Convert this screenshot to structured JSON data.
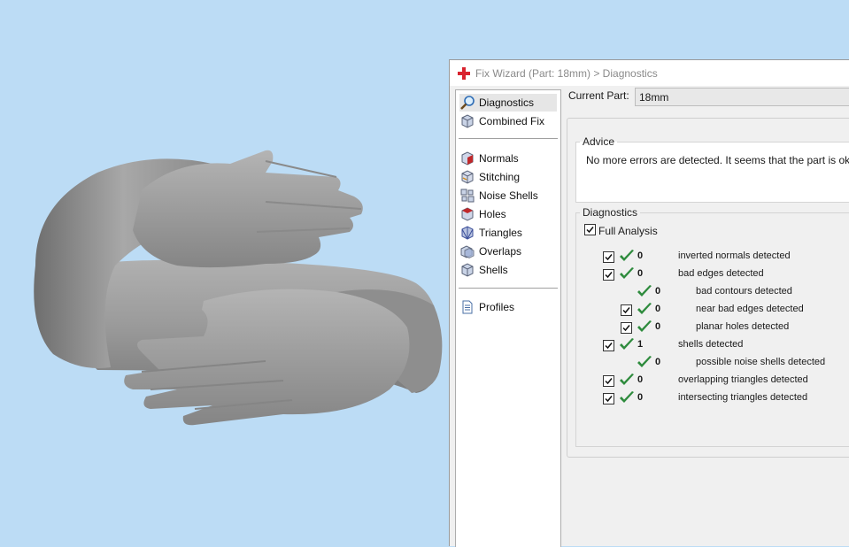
{
  "window": {
    "title": "Fix Wizard (Part: 18mm) > Diagnostics"
  },
  "nav": {
    "top": [
      {
        "name": "diagnostics",
        "label": "Diagnostics",
        "icon": "magnifier-icon",
        "selected": true
      },
      {
        "name": "combined-fix",
        "label": "Combined Fix",
        "icon": "cube-icon"
      }
    ],
    "tools": [
      {
        "name": "normals",
        "label": "Normals",
        "icon": "normals-cube-icon"
      },
      {
        "name": "stitching",
        "label": "Stitching",
        "icon": "stitching-cube-icon"
      },
      {
        "name": "noise-shells",
        "label": "Noise Shells",
        "icon": "noise-shells-icon"
      },
      {
        "name": "holes",
        "label": "Holes",
        "icon": "holes-cube-icon"
      },
      {
        "name": "triangles",
        "label": "Triangles",
        "icon": "triangles-icon"
      },
      {
        "name": "overlaps",
        "label": "Overlaps",
        "icon": "overlaps-icon"
      },
      {
        "name": "shells",
        "label": "Shells",
        "icon": "shells-icon"
      }
    ],
    "bottom": [
      {
        "name": "profiles",
        "label": "Profiles",
        "icon": "document-icon"
      }
    ]
  },
  "current_part": {
    "label": "Current Part:",
    "value": "18mm"
  },
  "advice": {
    "legend": "Advice",
    "text": "No more errors are detected. It seems that the part is ok."
  },
  "diagnostics": {
    "legend": "Diagnostics",
    "full_analysis": {
      "label": "Full Analysis",
      "checked": true
    },
    "rows": [
      {
        "count": "0",
        "label": "inverted normals detected",
        "level": 0,
        "checkbox": true
      },
      {
        "count": "0",
        "label": "bad edges detected",
        "level": 0,
        "checkbox": true
      },
      {
        "count": "0",
        "label": "bad contours detected",
        "level": 1,
        "checkbox": false
      },
      {
        "count": "0",
        "label": "near bad edges detected",
        "level": 1,
        "checkbox": true
      },
      {
        "count": "0",
        "label": "planar holes detected",
        "level": 1,
        "checkbox": true
      },
      {
        "count": "1",
        "label": "shells detected",
        "level": 0,
        "checkbox": true
      },
      {
        "count": "0",
        "label": "possible noise shells detected",
        "level": 1,
        "checkbox": false
      },
      {
        "count": "0",
        "label": "overlapping triangles detected",
        "level": 0,
        "checkbox": true
      },
      {
        "count": "0",
        "label": "intersecting triangles detected",
        "level": 0,
        "checkbox": true
      }
    ]
  },
  "colors": {
    "viewport_bg": "#bcdcf5",
    "tick_green": "#2e8b3d",
    "app_icon_red": "#d9232e"
  }
}
